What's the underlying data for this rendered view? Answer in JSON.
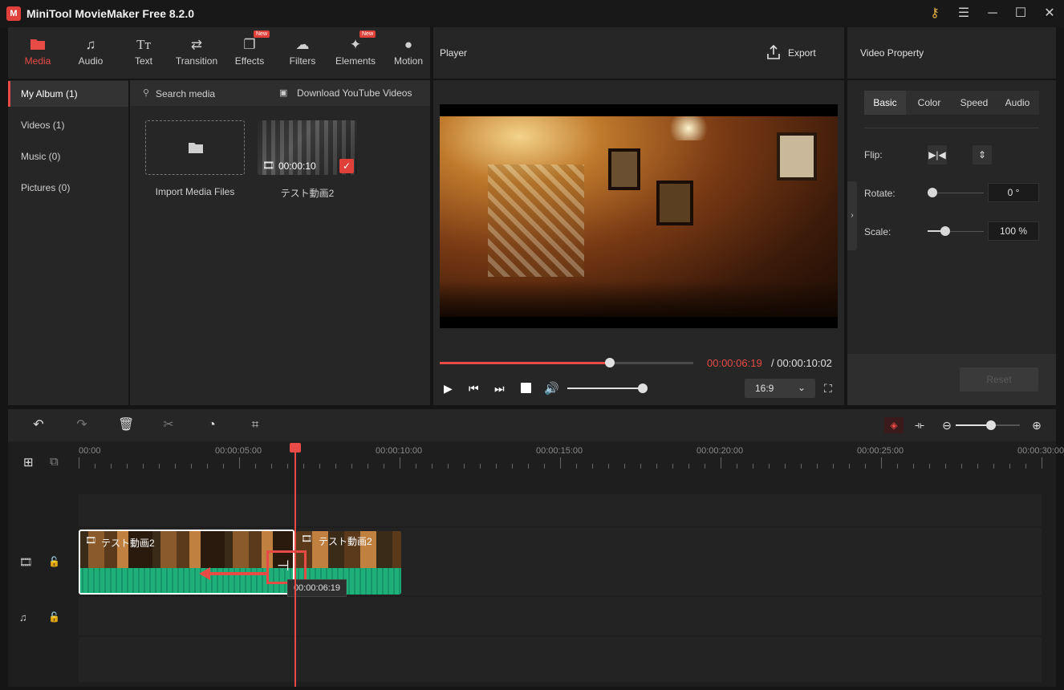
{
  "app": {
    "title": "MiniTool MovieMaker Free 8.2.0",
    "logo_text": "M"
  },
  "toolbar": {
    "items": [
      {
        "label": "Media",
        "icon": "folder-icon",
        "new": false
      },
      {
        "label": "Audio",
        "icon": "music-note-icon",
        "new": false
      },
      {
        "label": "Text",
        "icon": "text-icon",
        "new": false
      },
      {
        "label": "Transition",
        "icon": "transition-icon",
        "new": false
      },
      {
        "label": "Effects",
        "icon": "effects-icon",
        "new": true
      },
      {
        "label": "Filters",
        "icon": "filters-icon",
        "new": false
      },
      {
        "label": "Elements",
        "icon": "elements-icon",
        "new": true
      },
      {
        "label": "Motion",
        "icon": "motion-icon",
        "new": false
      }
    ],
    "new_badge": "New"
  },
  "album": {
    "items": [
      "My Album (1)",
      "Videos (1)",
      "Music (0)",
      "Pictures (0)"
    ]
  },
  "media": {
    "search_label": "Search media",
    "download_label": "Download YouTube Videos",
    "import_label": "Import Media Files",
    "clip_name": "テスト動画2",
    "clip_duration": "00:00:10"
  },
  "player": {
    "title": "Player",
    "export_label": "Export",
    "current_time": "00:00:06:19",
    "total_time": "/ 00:00:10:02",
    "aspect": "16:9",
    "progress_fraction": 0.67,
    "volume_fraction": 1.0
  },
  "property": {
    "title": "Video Property",
    "tabs": [
      "Basic",
      "Color",
      "Speed",
      "Audio"
    ],
    "flip_label": "Flip:",
    "rotate_label": "Rotate:",
    "rotate_value": "0 °",
    "scale_label": "Scale:",
    "scale_value": "100 %",
    "reset_label": "Reset"
  },
  "timeline": {
    "ruler": [
      "00:00",
      "00:00:05:00",
      "00:00:10:00",
      "00:00:15:00",
      "00:00:20:00",
      "00:00:25:00",
      "00:00:30:00"
    ],
    "clip1_name": "テスト動画2",
    "clip2_name": "テスト動画2",
    "tooltip_time": "00:00:06:19"
  },
  "colors": {
    "accent": "#e84a45",
    "audio_wave": "#1fb07a",
    "panel": "#262626"
  }
}
